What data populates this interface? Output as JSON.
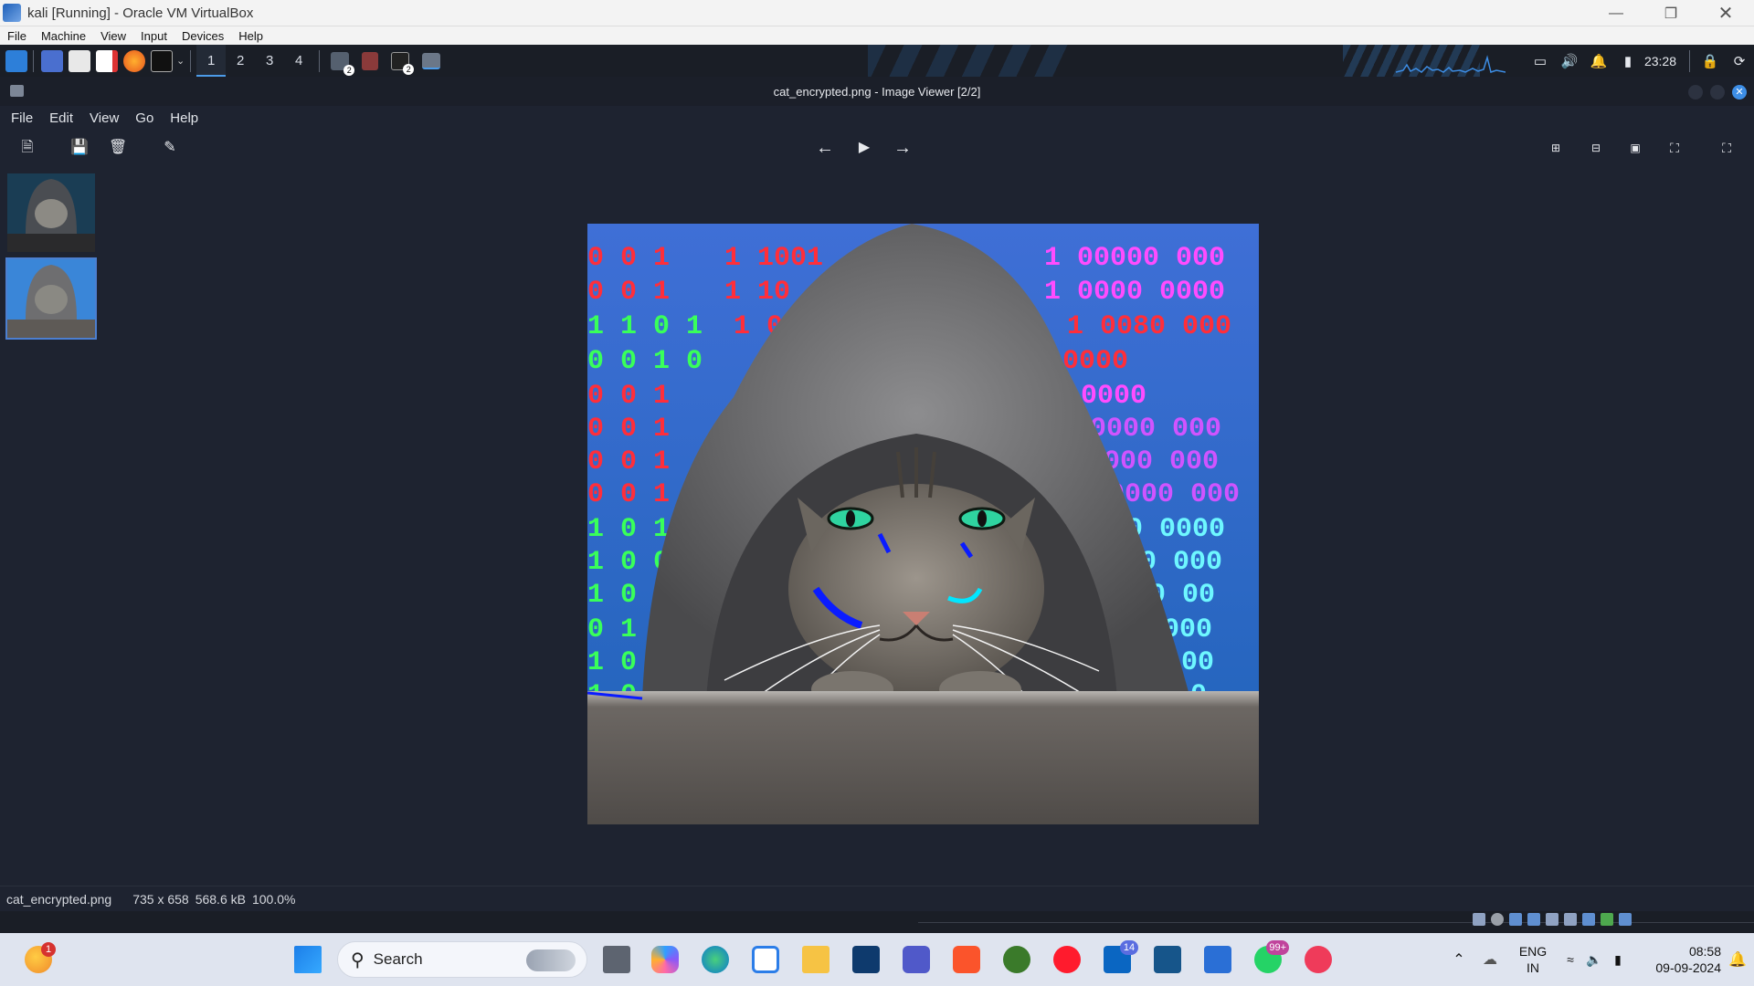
{
  "host": {
    "title": "kali [Running] - Oracle VM VirtualBox",
    "menu": [
      "File",
      "Machine",
      "View",
      "Input",
      "Devices",
      "Help"
    ]
  },
  "kali_panel": {
    "workspaces": [
      "1",
      "2",
      "3",
      "4"
    ],
    "active_workspace": "1",
    "badge_a": "2",
    "badge_b": "2",
    "clock": "23:28"
  },
  "viewer": {
    "title": "cat_encrypted.png - Image Viewer [2/2]",
    "menu": [
      "File",
      "Edit",
      "View",
      "Go",
      "Help"
    ],
    "status": {
      "filename": "cat_encrypted.png",
      "dimensions": "735 x 658",
      "size": "568.6 kB",
      "zoom": "100.0%"
    }
  },
  "taskbar": {
    "search_label": "Search",
    "weather_badge": "1",
    "linkedin_badge": "14",
    "whatsapp_badge": "99+",
    "lang_top": "ENG",
    "lang_bottom": "IN",
    "time": "08:58",
    "date": "09-09-2024"
  },
  "colors": {
    "accent": "#4c9be8",
    "panel": "#1a1e26",
    "viewer_bg": "#1e2330"
  }
}
